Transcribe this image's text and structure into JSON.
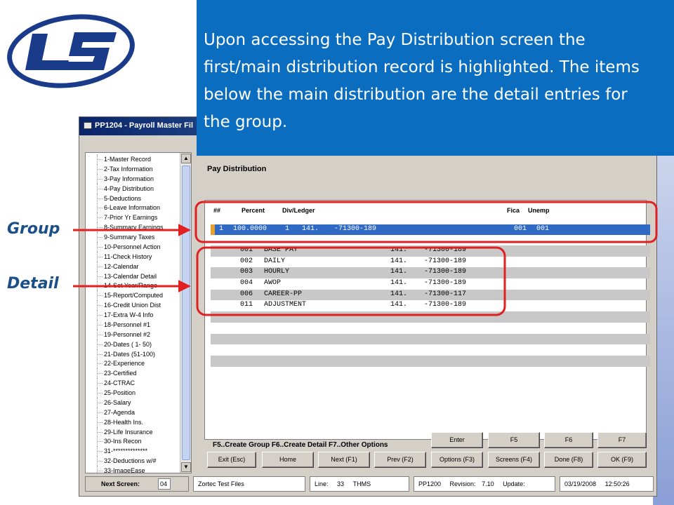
{
  "callout": {
    "text": "Upon accessing the Pay Distribution screen the first/main distribution record is highlighted.  The items below the main distribution are the detail entries for the group."
  },
  "annotations": {
    "group_label": "Group",
    "detail_label": "Detail",
    "color": "#e02020"
  },
  "window": {
    "title": "PP1204 - Payroll Master Fil"
  },
  "nav": {
    "items": [
      "1-Master Record",
      "2-Tax Information",
      "3-Pay Information",
      "4-Pay Distribution",
      "5-Deductions",
      "6-Leave Information",
      "7-Prior Yr Earnings",
      "8-Summary Earnings",
      "9-Summary Taxes",
      "10-Personnel Action",
      "11-Check History",
      "12-Calendar",
      "13-Calendar Detail",
      "14-Set Year/Range",
      "15-Report/Computed",
      "16-Credit Union Dist",
      "17-Extra W-4 Info",
      "18-Personnel #1",
      "19-Personnel #2",
      "20-Dates ( 1- 50)",
      "21-Dates (51-100)",
      "22-Experience",
      "23-Certified",
      "24-CTRAC",
      "25-Position",
      "26-Salary",
      "27-Agenda",
      "28-Health Ins.",
      "29-Life Insurance",
      "30-Ins Recon",
      "31-**************",
      "32-Deductions w/#",
      "33-ImageEase"
    ]
  },
  "main": {
    "section_title": "Pay Distribution",
    "headers": {
      "num": "##",
      "percent": "Percent",
      "divledger": "Div/Ledger",
      "fica": "Fica",
      "unemp": "Unemp"
    },
    "group_row": {
      "num": "1",
      "percent": "100.0000",
      "div": "1",
      "ledger1": "141.",
      "ledger2": "-71300-189",
      "fica": "001",
      "unemp": "001"
    },
    "detail_rows": [
      {
        "code": "001",
        "desc": "BASE PAY",
        "l1": "141.",
        "l2": "-71300-189"
      },
      {
        "code": "002",
        "desc": "DAILY",
        "l1": "141.",
        "l2": "-71300-189"
      },
      {
        "code": "003",
        "desc": "HOURLY",
        "l1": "141.",
        "l2": "-71300-189"
      },
      {
        "code": "004",
        "desc": "AWOP",
        "l1": "141.",
        "l2": "-71300-189"
      },
      {
        "code": "006",
        "desc": "CAREER-PP",
        "l1": "141.",
        "l2": "-71300-117"
      },
      {
        "code": "011",
        "desc": "ADJUSTMENT",
        "l1": "141.",
        "l2": "-71300-189"
      }
    ],
    "options_text": "F5..Create Group  F6..Create Detail  F7..Other Options"
  },
  "buttons": {
    "enter": "Enter",
    "f5": "F5",
    "f6": "F6",
    "f7": "F7",
    "exit": "Exit (Esc)",
    "home": "Home",
    "next": "Next (F1)",
    "prev": "Prev (F2)",
    "options": "Options (F3)",
    "screens": "Screens (F4)",
    "done": "Done (F8)",
    "ok": "OK (F9)"
  },
  "status": {
    "next_screen_label": "Next Screen:",
    "next_screen_value": "04",
    "db": "Zortec Test Files",
    "line_label": "Line:",
    "line_value": "33",
    "user": "THMS",
    "program": "PP1200",
    "revision_label": "Revision:",
    "revision_value": "7.10",
    "update_label": "Update:",
    "date": "03/19/2008",
    "time": "12:50:26"
  }
}
